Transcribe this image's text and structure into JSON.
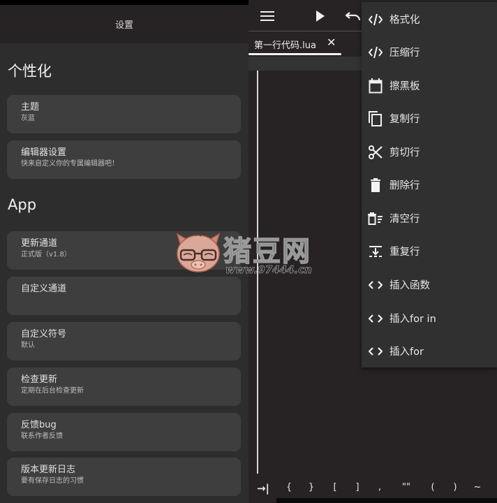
{
  "settings": {
    "title": "设置",
    "sections": [
      {
        "title": "个性化",
        "items": [
          {
            "title": "主题",
            "subtitle": "灰蓝"
          },
          {
            "title": "编辑器设置",
            "subtitle": "快来自定义你的专属编辑器吧！"
          }
        ]
      },
      {
        "title": "App",
        "items": [
          {
            "title": "更新通道",
            "subtitle": "正式版（v1.8）"
          },
          {
            "title": "自定义通道",
            "subtitle": ""
          },
          {
            "title": "自定义符号",
            "subtitle": "默认"
          },
          {
            "title": "检查更新",
            "subtitle": "定期在后台检查更新"
          },
          {
            "title": "反馈bug",
            "subtitle": "联系作者反馈"
          },
          {
            "title": "版本更新日志",
            "subtitle": "要有保存日志的习惯"
          }
        ]
      }
    ]
  },
  "editor": {
    "toolbar": {
      "menu_icon": "hamburger-icon",
      "run_icon": "play-icon",
      "undo_icon": "undo-icon"
    },
    "tab": {
      "label": "第一行代码.lua",
      "close_glyph": "✕"
    },
    "symbols": [
      "→|",
      "{",
      "}",
      "[",
      "]",
      ",",
      "\"\"",
      "(",
      ")",
      "~"
    ]
  },
  "menu": {
    "items": [
      {
        "label": "格式化",
        "icon": "code-icon"
      },
      {
        "label": "压缩行",
        "icon": "code-icon"
      },
      {
        "label": "擦黑板",
        "icon": "calendar-icon"
      },
      {
        "label": "复制行",
        "icon": "copy-icon"
      },
      {
        "label": "剪切行",
        "icon": "scissors-icon"
      },
      {
        "label": "删除行",
        "icon": "trash-icon"
      },
      {
        "label": "清空行",
        "icon": "clear-line-icon"
      },
      {
        "label": "重复行",
        "icon": "duplicate-line-icon"
      },
      {
        "label": "插入函数",
        "icon": "angle-brackets-icon"
      },
      {
        "label": "插入for in",
        "icon": "angle-brackets-icon"
      },
      {
        "label": "插入for",
        "icon": "angle-brackets-icon"
      }
    ]
  },
  "watermark": {
    "brand": "猪豆网",
    "url": "www.97444.cn"
  }
}
